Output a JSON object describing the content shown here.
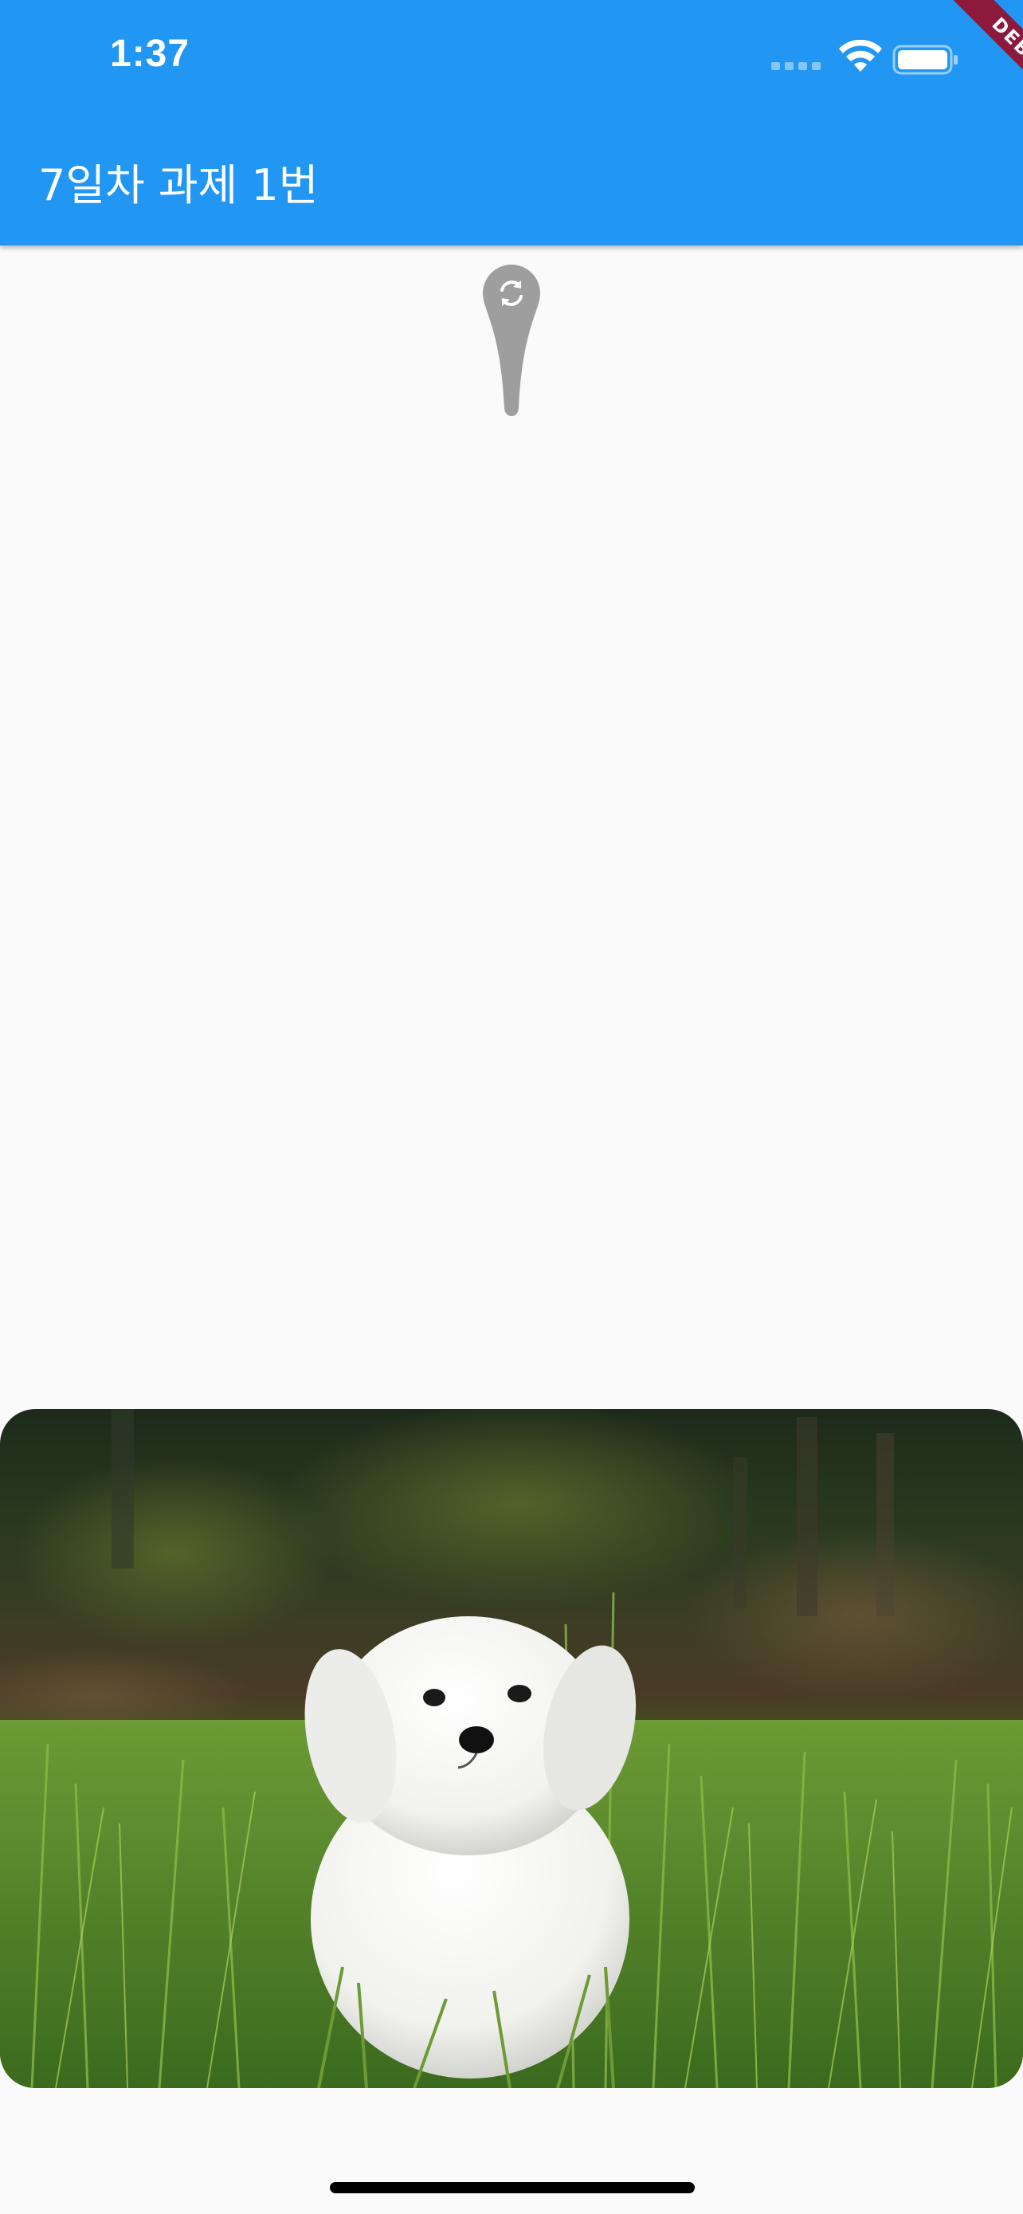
{
  "status_bar": {
    "time": "1:37"
  },
  "app_bar": {
    "title": "7일차 과제 1번",
    "background_color": "#2196f3"
  },
  "debug_banner": {
    "label": "DEBUG",
    "color": "#8b1a3c"
  },
  "refresh_indicator": {
    "icon": "refresh-icon"
  },
  "photo": {
    "subject": "dog-photo"
  }
}
